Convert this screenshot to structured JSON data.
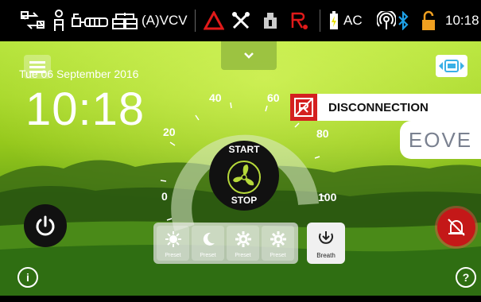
{
  "status_bar": {
    "mode": "(A)VCV",
    "power_source": "AC",
    "time": "10:18",
    "icons": [
      "network-transfer-icon",
      "patient-icon",
      "circuit-icon",
      "humidifier-icon",
      "alarm-triangle-icon",
      "tools-icon",
      "device-icon",
      "patient-alert-icon",
      "battery-icon",
      "signal-icon",
      "bluetooth-icon",
      "lock-icon"
    ]
  },
  "colors": {
    "alarm_red": "#d42020",
    "accent_green": "#a8d82c",
    "bluetooth_blue": "#1ea0e6",
    "lock_orange": "#f0a020",
    "battery_yellow": "#e8e000"
  },
  "header": {
    "menu_icon": "hamburger-menu-icon",
    "dropdown_icon": "chevron-down-icon",
    "camera_icon": "screen-swap-icon"
  },
  "datetime": {
    "date": "Tue 06 September 2016",
    "time": "10:18"
  },
  "gauge": {
    "labels": [
      "0",
      "20",
      "40",
      "60",
      "80",
      "100"
    ],
    "center_top": "START",
    "center_bottom": "STOP"
  },
  "alarm": {
    "text": "DISCONNECTION"
  },
  "brand": {
    "logo_text": "EOVE"
  },
  "presets": {
    "items": [
      {
        "label": "Preset",
        "icon": "sun-icon"
      },
      {
        "label": "Preset",
        "icon": "moon-icon"
      },
      {
        "label": "Preset",
        "icon": "gear-icon"
      },
      {
        "label": "Preset",
        "icon": "gear-icon"
      }
    ]
  },
  "breath": {
    "label": "Breath"
  }
}
